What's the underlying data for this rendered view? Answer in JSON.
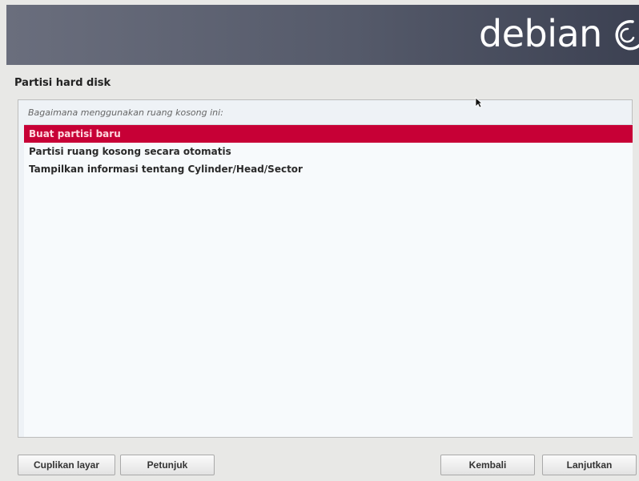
{
  "banner": {
    "brand": "debian",
    "icon": "debian-swirl-icon"
  },
  "page": {
    "title": "Partisi hard disk"
  },
  "question": "Bagaimana menggunakan ruang kosong ini:",
  "options": [
    {
      "label": "Buat partisi baru",
      "selected": true
    },
    {
      "label": "Partisi ruang kosong secara otomatis",
      "selected": false
    },
    {
      "label": "Tampilkan informasi tentang Cylinder/Head/Sector",
      "selected": false
    }
  ],
  "buttons": {
    "screenshot": "Cuplikan layar",
    "help": "Petunjuk",
    "back": "Kembali",
    "continue": "Lanjutkan"
  },
  "colors": {
    "selection": "#c70036",
    "banner": "#555a6a"
  }
}
